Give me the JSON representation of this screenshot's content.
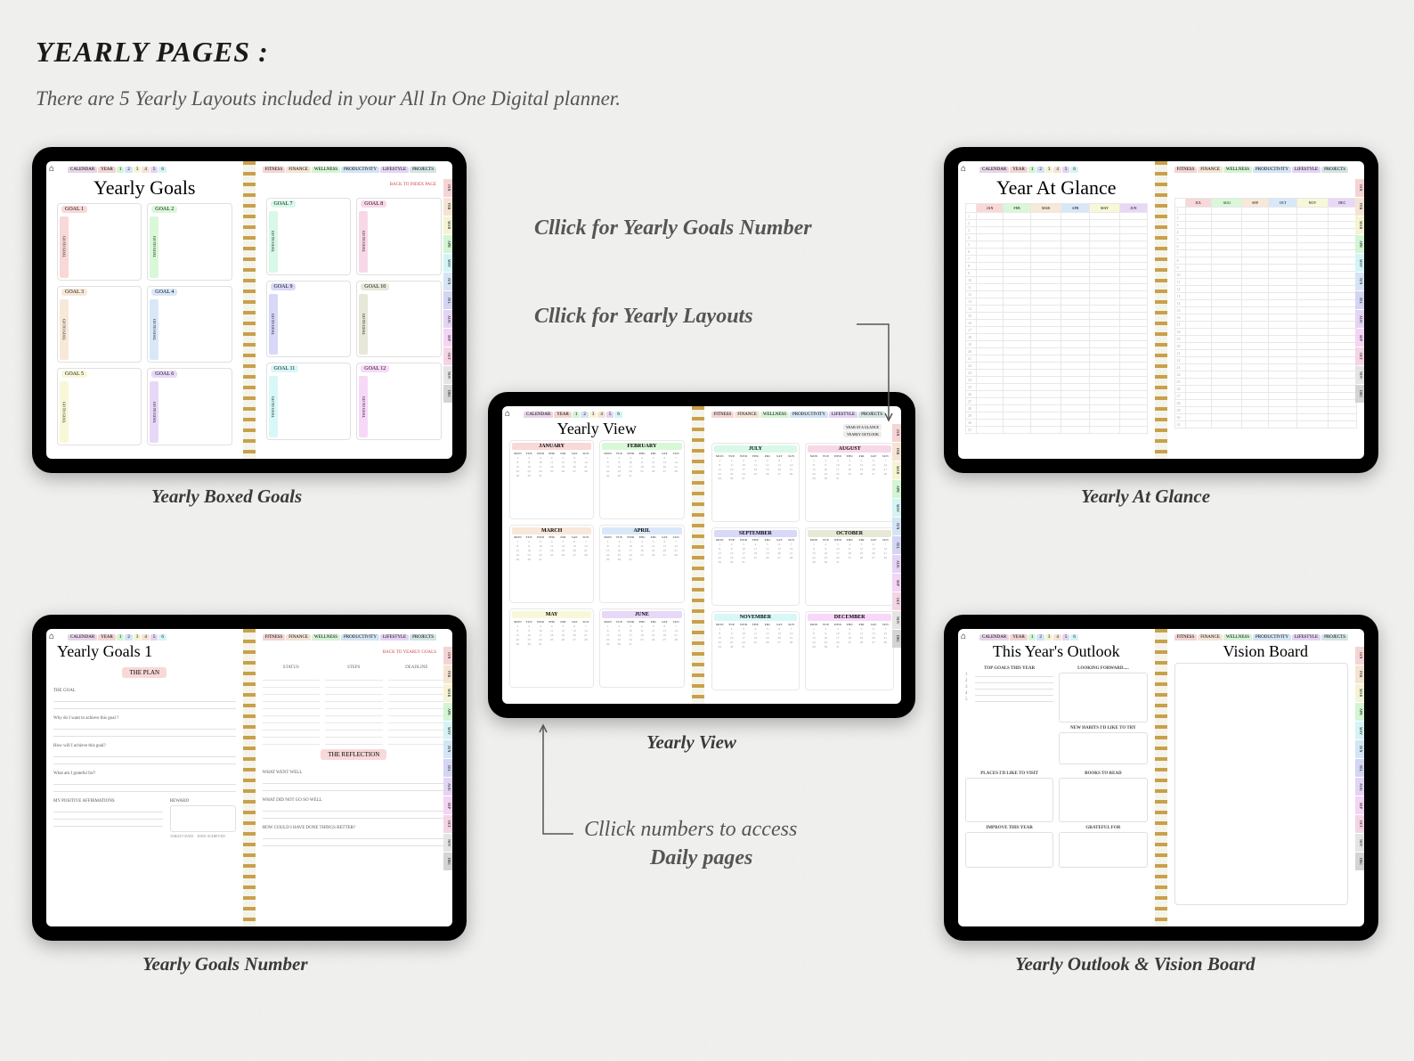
{
  "title": "YEARLY PAGES :",
  "subtitle": "There are 5 Yearly Layouts included in your All In One Digital planner.",
  "captions": {
    "tl": "Yearly Boxed Goals",
    "tr": "Yearly At Glance",
    "c": "Yearly View",
    "bl": "Yearly Goals Number",
    "br": "Yearly Outlook & Vision Board"
  },
  "annotations": {
    "a1": "Cllick for Yearly Goals Number",
    "a2": "Cllick for Yearly Layouts",
    "a3a": "Cllick numbers to access",
    "a3b": "Daily pages"
  },
  "tabs_left": [
    "CALENDAR",
    "YEAR",
    "1",
    "2",
    "3",
    "4",
    "5",
    "6"
  ],
  "tabs_right": [
    "FITNESS",
    "FINANCE",
    "WELLNESS",
    "PRODUCTIVITY",
    "LIFESTYLE",
    "PROJECTS"
  ],
  "side_tabs": [
    "JAN",
    "FEB",
    "MAR",
    "APR",
    "MAY",
    "JUN",
    "JUL",
    "AUG",
    "SEP",
    "OCT",
    "NOV",
    "DEC"
  ],
  "goals_page": {
    "title": "Yearly Goals",
    "back": "BACK TO INDEX PAGE",
    "boxes": [
      "GOAL 1",
      "GOAL 2",
      "GOAL 3",
      "GOAL 4",
      "GOAL 5",
      "GOAL 6",
      "GOAL 7",
      "GOAL 8",
      "GOAL 9",
      "GOAL 10",
      "GOAL 11",
      "GOAL 12"
    ],
    "goto": "GO TO GOAL"
  },
  "calendar_page": {
    "title": "Yearly View",
    "months": [
      "JANUARY",
      "FEBRUARY",
      "MARCH",
      "APRIL",
      "MAY",
      "JUNE",
      "JULY",
      "AUGUST",
      "SEPTEMBER",
      "OCTOBER",
      "NOVEMBER",
      "DECEMBER"
    ],
    "dow": [
      "MON",
      "TUE",
      "WED",
      "THU",
      "FRI",
      "SAT",
      "SUN"
    ],
    "buttons": [
      "YEAR AT A GLANCE",
      "YEARLY OUTLOOK"
    ]
  },
  "yag_page": {
    "title": "Year At Glance",
    "headers_l": [
      "JAN",
      "FEB",
      "MAR",
      "APR",
      "MAY",
      "JUN"
    ],
    "headers_r": [
      "JUL",
      "AUG",
      "SEP",
      "OCT",
      "NOV",
      "DEC"
    ]
  },
  "goals1_page": {
    "title": "Yearly Goals 1",
    "back": "BACK TO YEARLY GOALS",
    "plan": "THE PLAN",
    "reflection": "THE REFLECTION",
    "labels": {
      "the_goal": "THE GOAL",
      "why": "Why do I want to achieve this goal ?",
      "how": "How will I achieve this goal?",
      "grateful": "What am I grateful for?",
      "affirm": "MY POSITIVE AFFIRMATIONS",
      "reward": "REWARD",
      "target": "TARGET DATE",
      "achieved": "DATE ACHIEVED",
      "status": "STATUS",
      "steps": "STEPS",
      "deadline": "DEADLINE",
      "went_well": "WHAT WENT WELL",
      "not_well": "WHAT DID NOT GO SO WELL",
      "better": "HOW COULD I HAVE DONE THINGS BETTER?"
    }
  },
  "outlook_page": {
    "title_l": "This Year's Outlook",
    "title_r": "Vision Board",
    "sections": {
      "top_goals": "TOP GOALS THIS YEAR",
      "looking": "LOOKING FORWARD.....",
      "habits": "NEW HABITS I'D LIKE TO TRY",
      "places": "PLACES I'D LIKE TO VISIT",
      "books": "BOOKS TO READ",
      "improve": "IMPROVE THIS YEAR",
      "grateful": "GRATEFUL FOR"
    },
    "nums": [
      "1",
      "2",
      "3",
      "4",
      "5"
    ]
  }
}
